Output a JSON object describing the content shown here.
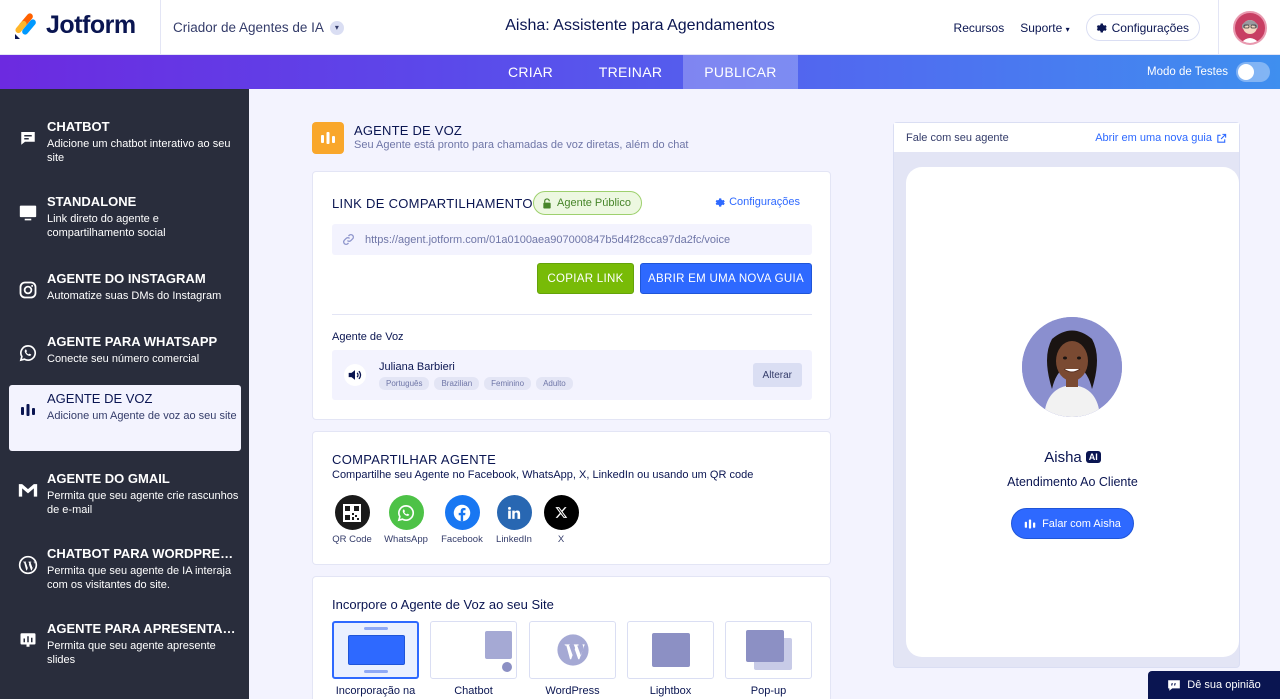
{
  "header": {
    "logo_text": "Jotform",
    "product_switch": "Criador de Agentes de IA",
    "app_title": "Aisha: Assistente para Agendamentos",
    "resources": "Recursos",
    "support": "Suporte",
    "settings": "Configurações"
  },
  "tabs": [
    {
      "label": "CRIAR"
    },
    {
      "label": "TREINAR"
    },
    {
      "label": "PUBLICAR",
      "active": true
    }
  ],
  "test_mode": {
    "label": "Modo de Testes",
    "on": false
  },
  "sidebar": {
    "items": [
      {
        "title": "CHATBOT",
        "desc": "Adicione um chatbot interativo ao seu site",
        "icon": "chat-icon"
      },
      {
        "title": "STANDALONE",
        "desc": "Link direto do agente e compartilhamento social",
        "icon": "monitor-icon"
      },
      {
        "title": "AGENTE DO INSTAGRAM",
        "desc": "Automatize suas DMs do Instagram",
        "icon": "instagram-icon"
      },
      {
        "title": "AGENTE PARA WHATSAPP",
        "desc": "Conecte seu número comercial",
        "icon": "whatsapp-icon"
      },
      {
        "title": "AGENTE DE VOZ",
        "desc": "Adicione um Agente de voz ao seu site",
        "icon": "voice-bars-icon",
        "active": true
      },
      {
        "title": "AGENTE DO GMAIL",
        "desc": "Permita que seu agente crie rascunhos de e-mail",
        "icon": "gmail-icon"
      },
      {
        "title": "CHATBOT PARA WORDPRESS",
        "desc": "Permita que seu agente de IA interaja com os visitantes do site.",
        "icon": "wordpress-icon"
      },
      {
        "title": "AGENTE PARA APRESENTAÇ...",
        "desc": "Permita que seu agente apresente slides",
        "icon": "presentation-icon"
      }
    ]
  },
  "hero": {
    "title": "AGENTE DE VOZ",
    "subtitle": "Seu Agente está pronto para chamadas de voz diretas, além do chat"
  },
  "share_link": {
    "title": "LINK DE COMPARTILHAMENTO",
    "badge": "Agente Público",
    "settings": "Configurações",
    "url": "https://agent.jotform.com/01a0100aea907000847b5d4f28cca97da2fc/voice",
    "copy_button": "COPIAR LINK",
    "open_button": "ABRIR EM UMA NOVA GUIA"
  },
  "voice": {
    "label": "Agente de Voz",
    "name": "Juliana Barbieri",
    "tags": [
      "Português",
      "Brazilian",
      "Feminino",
      "Adulto"
    ],
    "change_button": "Alterar"
  },
  "share_agent": {
    "title": "COMPARTILHAR AGENTE",
    "subtitle": "Compartilhe seu Agente no Facebook, WhatsApp, X, LinkedIn ou usando um QR code",
    "options": [
      {
        "label": "QR Code",
        "icon": "qr-code-icon",
        "color": "#1a1a1a"
      },
      {
        "label": "WhatsApp",
        "icon": "whatsapp-icon",
        "color": "#4dc247"
      },
      {
        "label": "Facebook",
        "icon": "facebook-icon",
        "color": "#1877f2"
      },
      {
        "label": "LinkedIn",
        "icon": "linkedin-icon",
        "color": "#2867b2"
      },
      {
        "label": "X",
        "icon": "x-icon",
        "color": "#000000"
      }
    ]
  },
  "embed": {
    "title": "Incorpore o Agente de Voz ao seu Site",
    "options": [
      {
        "label": "Incorporação na",
        "active": true
      },
      {
        "label": "Chatbot"
      },
      {
        "label": "WordPress"
      },
      {
        "label": "Lightbox"
      },
      {
        "label": "Pop-up"
      }
    ]
  },
  "preview": {
    "label": "Fale com seu agente",
    "open_link": "Abrir em uma nova guia",
    "agent_name": "Aisha",
    "ai_badge": "AI",
    "agent_role": "Atendimento Ao Cliente",
    "talk_button": "Falar com Aisha"
  },
  "feedback": "Dê sua opinião",
  "colors": {
    "accent": "#2e69ff",
    "green": "#78bb07",
    "navy": "#0a1551",
    "sidebar_bg": "#292d3c",
    "voice_icon_bg": "#f9a72b"
  }
}
